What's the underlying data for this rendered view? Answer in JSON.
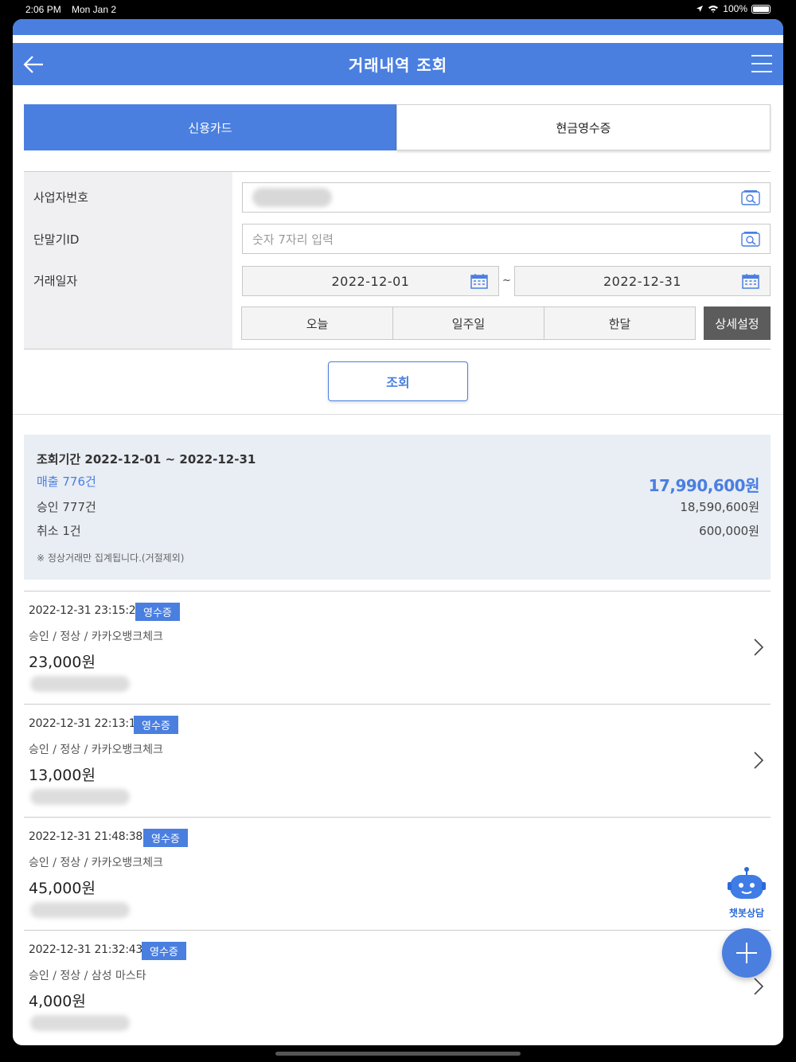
{
  "status_bar": {
    "time": "2:06 PM",
    "date": "Mon Jan 2",
    "battery": "100%"
  },
  "header": {
    "title": "거래내역 조회"
  },
  "tabs": [
    {
      "label": "신용카드",
      "active": true
    },
    {
      "label": "현금영수증",
      "active": false
    }
  ],
  "form": {
    "business_number_label": "사업자번호",
    "terminal_id_label": "단말기ID",
    "terminal_id_placeholder": "숫자 7자리 입력",
    "date_label": "거래일자",
    "date_from": "2022-12-01",
    "date_separator": "~",
    "date_to": "2022-12-31",
    "quick_ranges": [
      "오늘",
      "일주일",
      "한달"
    ],
    "detail_setting_label": "상세설정"
  },
  "search_button": "조회",
  "summary": {
    "period": "조회기간  2022-12-01 ~ 2022-12-31",
    "sales_label": "매출 776건",
    "sales_amount": "17,990,600원",
    "approve_label": "승인 777건",
    "approve_amount": "18,590,600원",
    "cancel_label": "취소 1건",
    "cancel_amount": "600,000원",
    "note": "※ 정상거래만 집계됩니다.(거절제외)"
  },
  "transactions": [
    {
      "timestamp": "2022-12-31 23:15:21",
      "badge": "영수증",
      "description": "승인 / 정상 / 카카오뱅크체크",
      "amount": "23,000원"
    },
    {
      "timestamp": "2022-12-31 22:13:15",
      "badge": "영수증",
      "description": "승인 / 정상 / 카카오뱅크체크",
      "amount": "13,000원"
    },
    {
      "timestamp": "2022-12-31 21:48:38",
      "badge": "영수증",
      "description": "승인 / 정상 / 카카오뱅크체크",
      "amount": "45,000원"
    },
    {
      "timestamp": "2022-12-31 21:32:43",
      "badge": "영수증",
      "description": "승인 / 정상 / 삼성 마스타",
      "amount": "4,000원"
    }
  ],
  "chatbot": {
    "label": "챗봇상담",
    "icon": "robot-icon"
  },
  "colors": {
    "primary": "#4a7fe0",
    "summary_bg": "#e9edf4",
    "dark_button": "#5c5c5c"
  }
}
